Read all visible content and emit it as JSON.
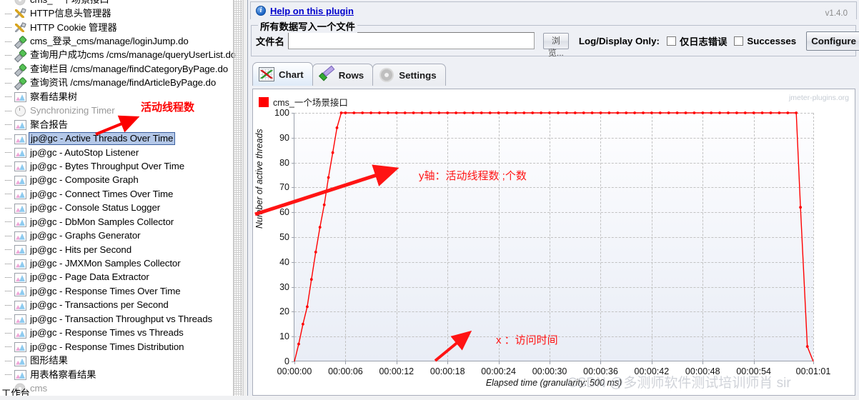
{
  "sidebar": {
    "items": [
      {
        "label": "cms_一个场景接口",
        "icon": "gear-icon",
        "state": "partial-top"
      },
      {
        "label": "HTTP信息头管理器",
        "icon": "config-tool-icon"
      },
      {
        "label": "HTTP Cookie 管理器",
        "icon": "config-tool-icon"
      },
      {
        "label": "cms_登录_cms/manage/loginJump.do",
        "icon": "sampler-icon"
      },
      {
        "label": "查询用户成功cms /cms/manage/queryUserList.do",
        "icon": "sampler-icon"
      },
      {
        "label": "查询栏目 /cms/manage/findCategoryByPage.do",
        "icon": "sampler-icon"
      },
      {
        "label": "查询资讯 /cms/manage/findArticleByPage.do",
        "icon": "sampler-icon"
      },
      {
        "label": "察看结果树",
        "icon": "listener-graph-icon"
      },
      {
        "label": "Synchronizing Timer",
        "icon": "timer-icon",
        "disabled": true
      },
      {
        "label": "聚合报告",
        "icon": "listener-graph-icon"
      },
      {
        "label": "jp@gc - Active Threads Over Time",
        "icon": "listener-graph-icon",
        "selected": true
      },
      {
        "label": "jp@gc - AutoStop Listener",
        "icon": "listener-graph-icon"
      },
      {
        "label": "jp@gc - Bytes Throughput Over Time",
        "icon": "listener-graph-icon"
      },
      {
        "label": "jp@gc - Composite Graph",
        "icon": "listener-graph-icon"
      },
      {
        "label": "jp@gc - Connect Times Over Time",
        "icon": "listener-graph-icon"
      },
      {
        "label": "jp@gc - Console Status Logger",
        "icon": "listener-graph-icon"
      },
      {
        "label": "jp@gc - DbMon Samples Collector",
        "icon": "listener-graph-icon"
      },
      {
        "label": "jp@gc - Graphs Generator",
        "icon": "listener-graph-icon"
      },
      {
        "label": "jp@gc - Hits per Second",
        "icon": "listener-graph-icon"
      },
      {
        "label": "jp@gc - JMXMon Samples Collector",
        "icon": "listener-graph-icon"
      },
      {
        "label": "jp@gc - Page Data Extractor",
        "icon": "listener-graph-icon"
      },
      {
        "label": "jp@gc - Response Times Over Time",
        "icon": "listener-graph-icon"
      },
      {
        "label": "jp@gc - Transactions per Second",
        "icon": "listener-graph-icon"
      },
      {
        "label": "jp@gc - Transaction Throughput vs Threads",
        "icon": "listener-graph-icon"
      },
      {
        "label": "jp@gc - Response Times vs Threads",
        "icon": "listener-graph-icon"
      },
      {
        "label": "jp@gc - Response Times Distribution",
        "icon": "listener-graph-icon"
      },
      {
        "label": "图形结果",
        "icon": "listener-graph-icon"
      },
      {
        "label": "用表格察看结果",
        "icon": "listener-graph-icon"
      },
      {
        "label": "cms",
        "icon": "gear-icon",
        "disabled": true
      }
    ],
    "workbench_label": "工作台",
    "annotation": "活动线程数"
  },
  "header": {
    "help_link": "Help on this plugin",
    "info_icon": "info-icon",
    "version": "v1.4.0"
  },
  "file_group": {
    "title": "所有数据写入一个文件",
    "filename_label": "文件名",
    "filename_value": "",
    "filename_placeholder": "",
    "browse_label": "浏览...",
    "log_display_label": "Log/Display Only:",
    "errors_only_label": "仅日志错误",
    "errors_only_checked": false,
    "successes_label": "Successes",
    "successes_checked": false,
    "configure_label": "Configure"
  },
  "tabs": [
    {
      "label": "Chart",
      "icon": "chart-icon",
      "active": true
    },
    {
      "label": "Rows",
      "icon": "check-icon",
      "active": false
    },
    {
      "label": "Settings",
      "icon": "gear-icon",
      "active": false
    }
  ],
  "chart_watermark": "jmeter-plugins.org",
  "csdn_watermark": "CSDN @多测师软件测试培训师肖 sir",
  "annotations": {
    "y_axis_note": "y轴：活动线程数 ;个数",
    "x_axis_note": "x ：访问时间"
  },
  "chart_data": {
    "type": "line",
    "title": "",
    "legend": [
      {
        "name": "cms_一个场景接口",
        "color": "#ff0000"
      }
    ],
    "legend_position": "top-left",
    "grid": true,
    "xlabel": "Elapsed time (granularity: 500 ms)",
    "ylabel": "Number of active threads",
    "ylim": [
      0,
      100
    ],
    "yticks": [
      0,
      10,
      20,
      30,
      40,
      50,
      60,
      70,
      80,
      90,
      100
    ],
    "xlim_seconds": [
      0,
      61
    ],
    "xticks": [
      "00:00:00",
      "00:00:06",
      "00:00:12",
      "00:00:18",
      "00:00:24",
      "00:00:30",
      "00:00:36",
      "00:00:42",
      "00:00:48",
      "00:00:54",
      "00:01:01"
    ],
    "xtick_seconds": [
      0,
      6,
      12,
      18,
      24,
      30,
      36,
      42,
      48,
      54,
      61
    ],
    "series": [
      {
        "name": "cms_一个场景接口",
        "color": "#ff0000",
        "x": [
          0.0,
          0.5,
          1.0,
          1.5,
          2.0,
          2.5,
          3.0,
          3.5,
          4.0,
          4.5,
          5.0,
          5.5,
          6.0,
          7.0,
          8.0,
          9.0,
          10.0,
          11.0,
          12.0,
          13.0,
          14.0,
          15.0,
          16.0,
          17.0,
          18.0,
          19.0,
          20.0,
          21.0,
          22.0,
          23.0,
          24.0,
          25.0,
          26.0,
          27.0,
          28.0,
          29.0,
          30.0,
          31.0,
          32.0,
          33.0,
          34.0,
          35.0,
          36.0,
          37.0,
          38.0,
          39.0,
          40.0,
          41.0,
          42.0,
          43.0,
          44.0,
          45.0,
          46.0,
          47.0,
          48.0,
          49.0,
          50.0,
          51.0,
          52.0,
          53.0,
          54.0,
          55.0,
          56.0,
          57.0,
          58.0,
          59.0,
          59.5,
          60.3,
          61.0
        ],
        "y": [
          0,
          7,
          15,
          22,
          33,
          44,
          54,
          63,
          74,
          84,
          94,
          100,
          100,
          100,
          100,
          100,
          100,
          100,
          100,
          100,
          100,
          100,
          100,
          100,
          100,
          100,
          100,
          100,
          100,
          100,
          100,
          100,
          100,
          100,
          100,
          100,
          100,
          100,
          100,
          100,
          100,
          100,
          100,
          100,
          100,
          100,
          100,
          100,
          100,
          100,
          100,
          100,
          100,
          100,
          100,
          100,
          100,
          100,
          100,
          100,
          100,
          100,
          100,
          100,
          100,
          100,
          62,
          6,
          0
        ]
      }
    ]
  }
}
